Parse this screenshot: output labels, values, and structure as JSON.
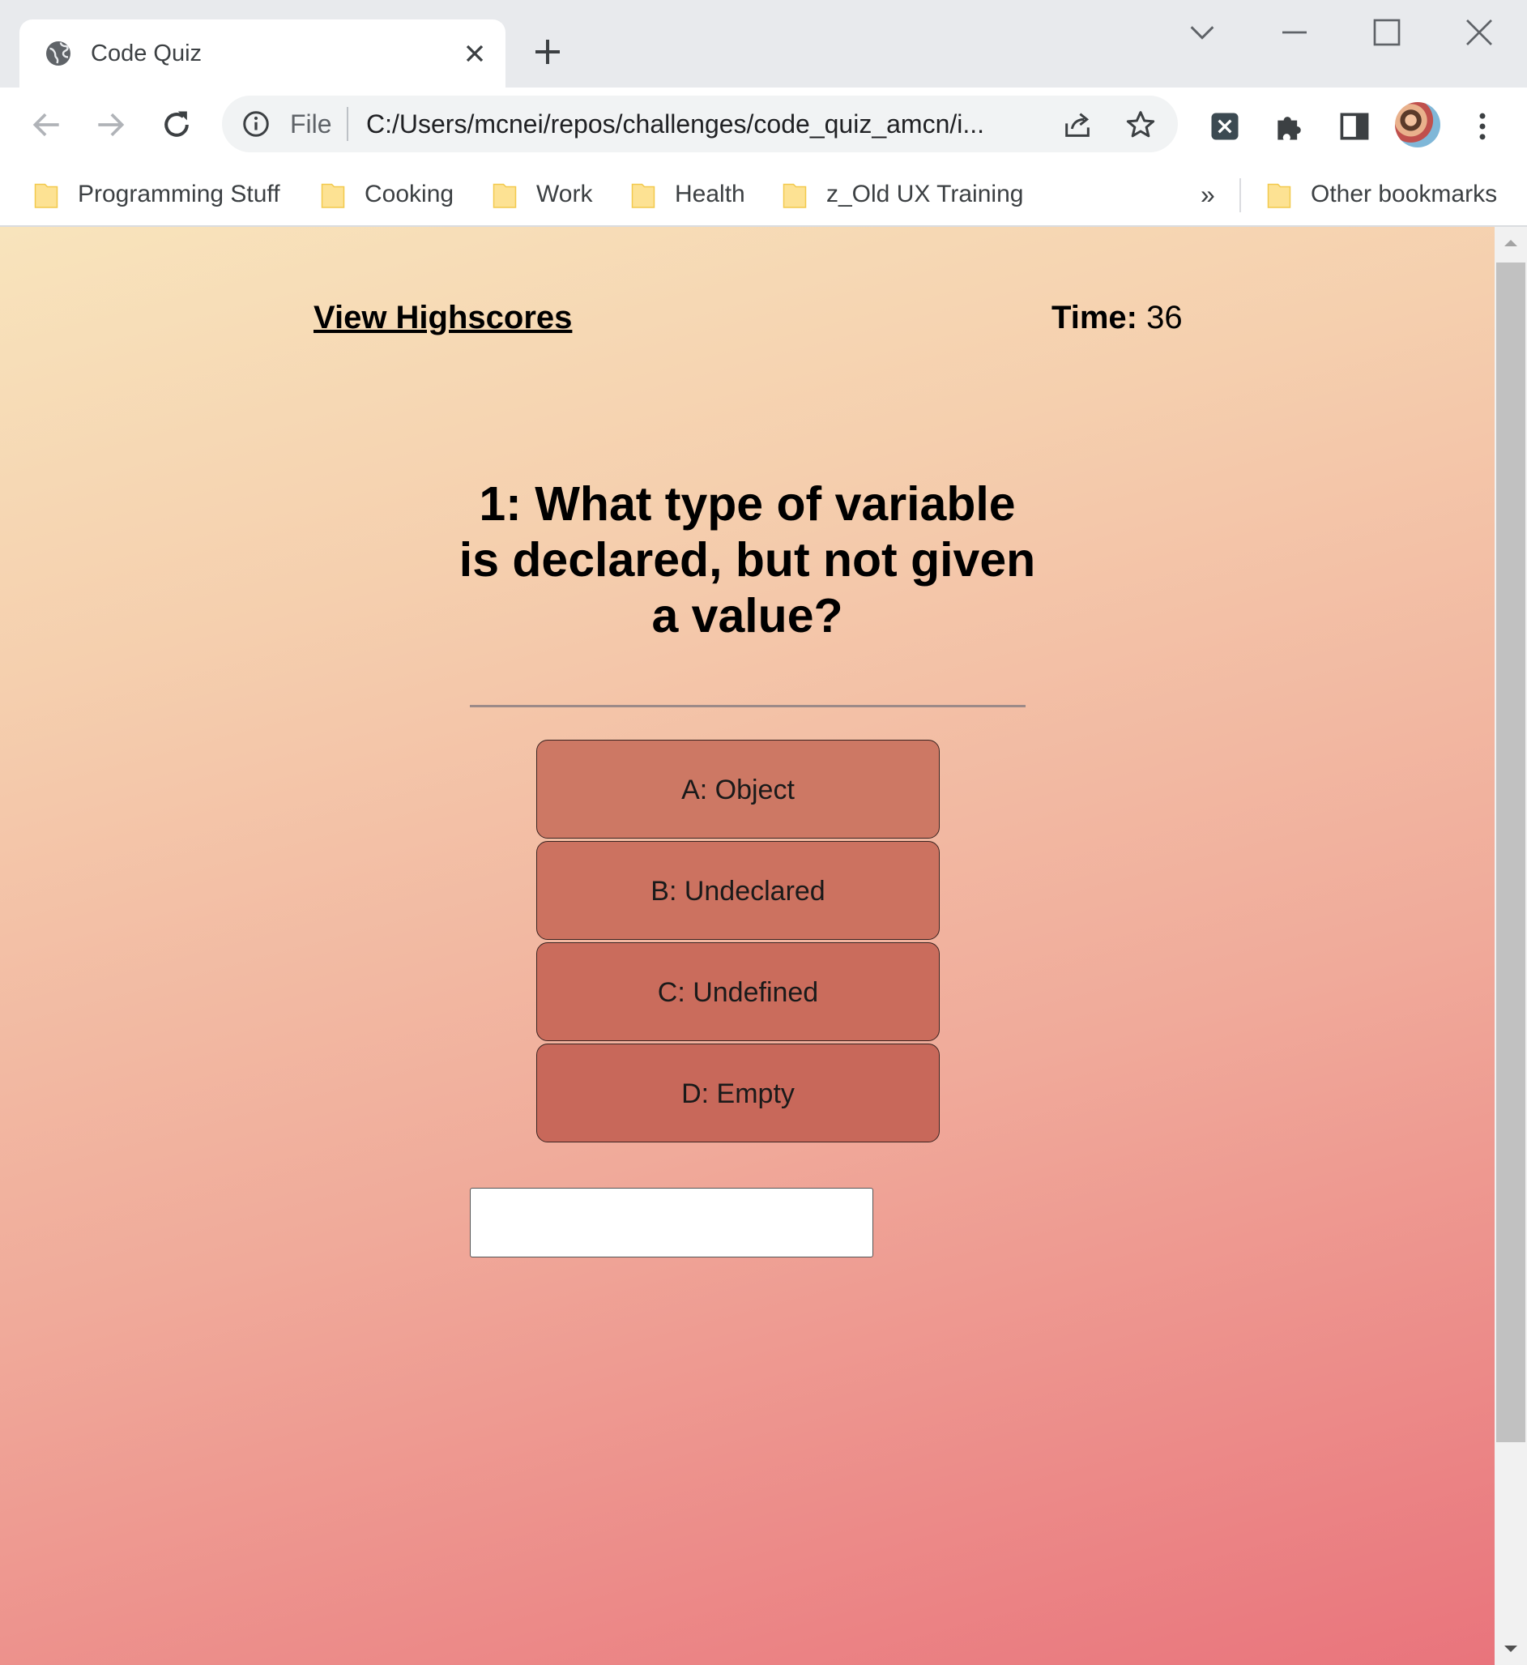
{
  "browser": {
    "tab": {
      "title": "Code Quiz",
      "favicon": "globe-icon",
      "close_icon": "close-icon"
    },
    "new_tab_icon": "plus-icon",
    "window_controls": [
      "chevron-down-icon",
      "minimize-icon",
      "maximize-icon",
      "close-icon"
    ],
    "toolbar": {
      "back_icon": "arrow-left-icon",
      "forward_icon": "arrow-right-icon",
      "reload_icon": "reload-icon",
      "omnibox": {
        "info_icon": "info-icon",
        "scheme_label": "File",
        "url": "C:/Users/mcnei/repos/challenges/code_quiz_amcn/i...",
        "share_icon": "share-icon",
        "star_icon": "star-icon"
      },
      "extensions": [
        "extension-x-icon",
        "puzzle-icon",
        "side-panel-icon"
      ],
      "avatar": "avatar",
      "menu_icon": "kebab-menu-icon"
    },
    "bookmarks": {
      "items": [
        {
          "label": "Programming Stuff"
        },
        {
          "label": "Cooking"
        },
        {
          "label": "Work"
        },
        {
          "label": "Health"
        },
        {
          "label": "z_Old UX Training"
        }
      ],
      "more_label": "»",
      "other_label": "Other bookmarks"
    }
  },
  "page": {
    "highscores_link": "View Highscores",
    "timer": {
      "label": "Time:",
      "value": "36"
    },
    "question": "1: What type of variable is declared, but not given a value?",
    "answers": [
      {
        "label": "A: Object",
        "color": "#cd7864"
      },
      {
        "label": "B: Undeclared",
        "color": "#cc7260"
      },
      {
        "label": "C: Undefined",
        "color": "#ca6c5c"
      },
      {
        "label": "D: Empty",
        "color": "#c8685a"
      }
    ],
    "feedback_value": "",
    "background_gradient": [
      "#f8e4bc",
      "#f5cfae",
      "#f0aa9a",
      "#e9747c"
    ]
  }
}
